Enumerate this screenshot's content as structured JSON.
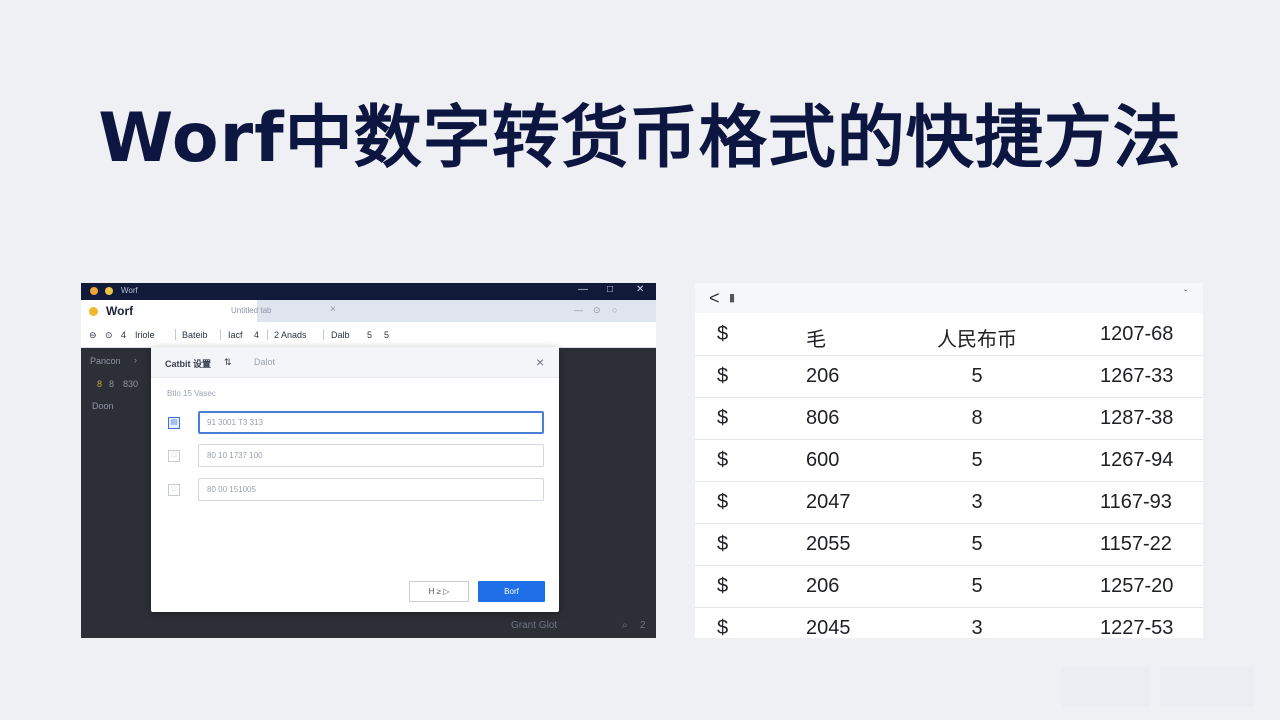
{
  "title": "Worf中数字转货币格式的快捷方法",
  "app": {
    "window_title": "Worf",
    "tab": {
      "name": "Worf",
      "secondary": "Untitled tab",
      "close": "×"
    },
    "window_controls": {
      "minimize": "—",
      "maximize": "□",
      "close": "✕"
    },
    "tab_controls": {
      "min": "—",
      "refresh": "⊙",
      "close": "○"
    },
    "menubar": {
      "items": [
        "⊖",
        "⊙",
        "4",
        "Iriole",
        "Bateib",
        "Iacf",
        "4",
        "2 Anads",
        "Dalb",
        "5",
        "5"
      ]
    },
    "sidebar": {
      "item1": "Pancon",
      "item1_arrow": "›",
      "item2a": "8",
      "item2b": "8",
      "item2c": "830",
      "item3": "Doon"
    },
    "status": {
      "text": "Grant Glot",
      "icon1": "⌕",
      "icon2": "2"
    },
    "dialog": {
      "title": "Catbit 设置",
      "title_icon": "⇅",
      "tab2": "Dalot",
      "close": "×",
      "subtitle": "Btlo 15 Vasec",
      "fields": [
        {
          "icon": "▤",
          "value": "91 3001 T3 313"
        },
        {
          "icon": "□",
          "value": "80 10 1737 100"
        },
        {
          "icon": "□",
          "value": "80 00 151005"
        }
      ],
      "buttons": {
        "secondary": "H ≥ ▷",
        "primary": "Borf"
      }
    }
  },
  "table": {
    "back": "<",
    "icon": "▮",
    "chevron": "ˇ",
    "rows": [
      [
        "$",
        "毛",
        "人民布币",
        "1207-68"
      ],
      [
        "$",
        "206",
        "5",
        "1267-33"
      ],
      [
        "$",
        "806",
        "8",
        "1287-38"
      ],
      [
        "$",
        "600",
        "5",
        "1267-94"
      ],
      [
        "$",
        "2047",
        "3",
        "1167-93"
      ],
      [
        "$",
        "2055",
        "5",
        "1157-22"
      ],
      [
        "$",
        "206",
        "5",
        "1257-20"
      ],
      [
        "$",
        "2045",
        "3",
        "1227-53"
      ]
    ]
  }
}
